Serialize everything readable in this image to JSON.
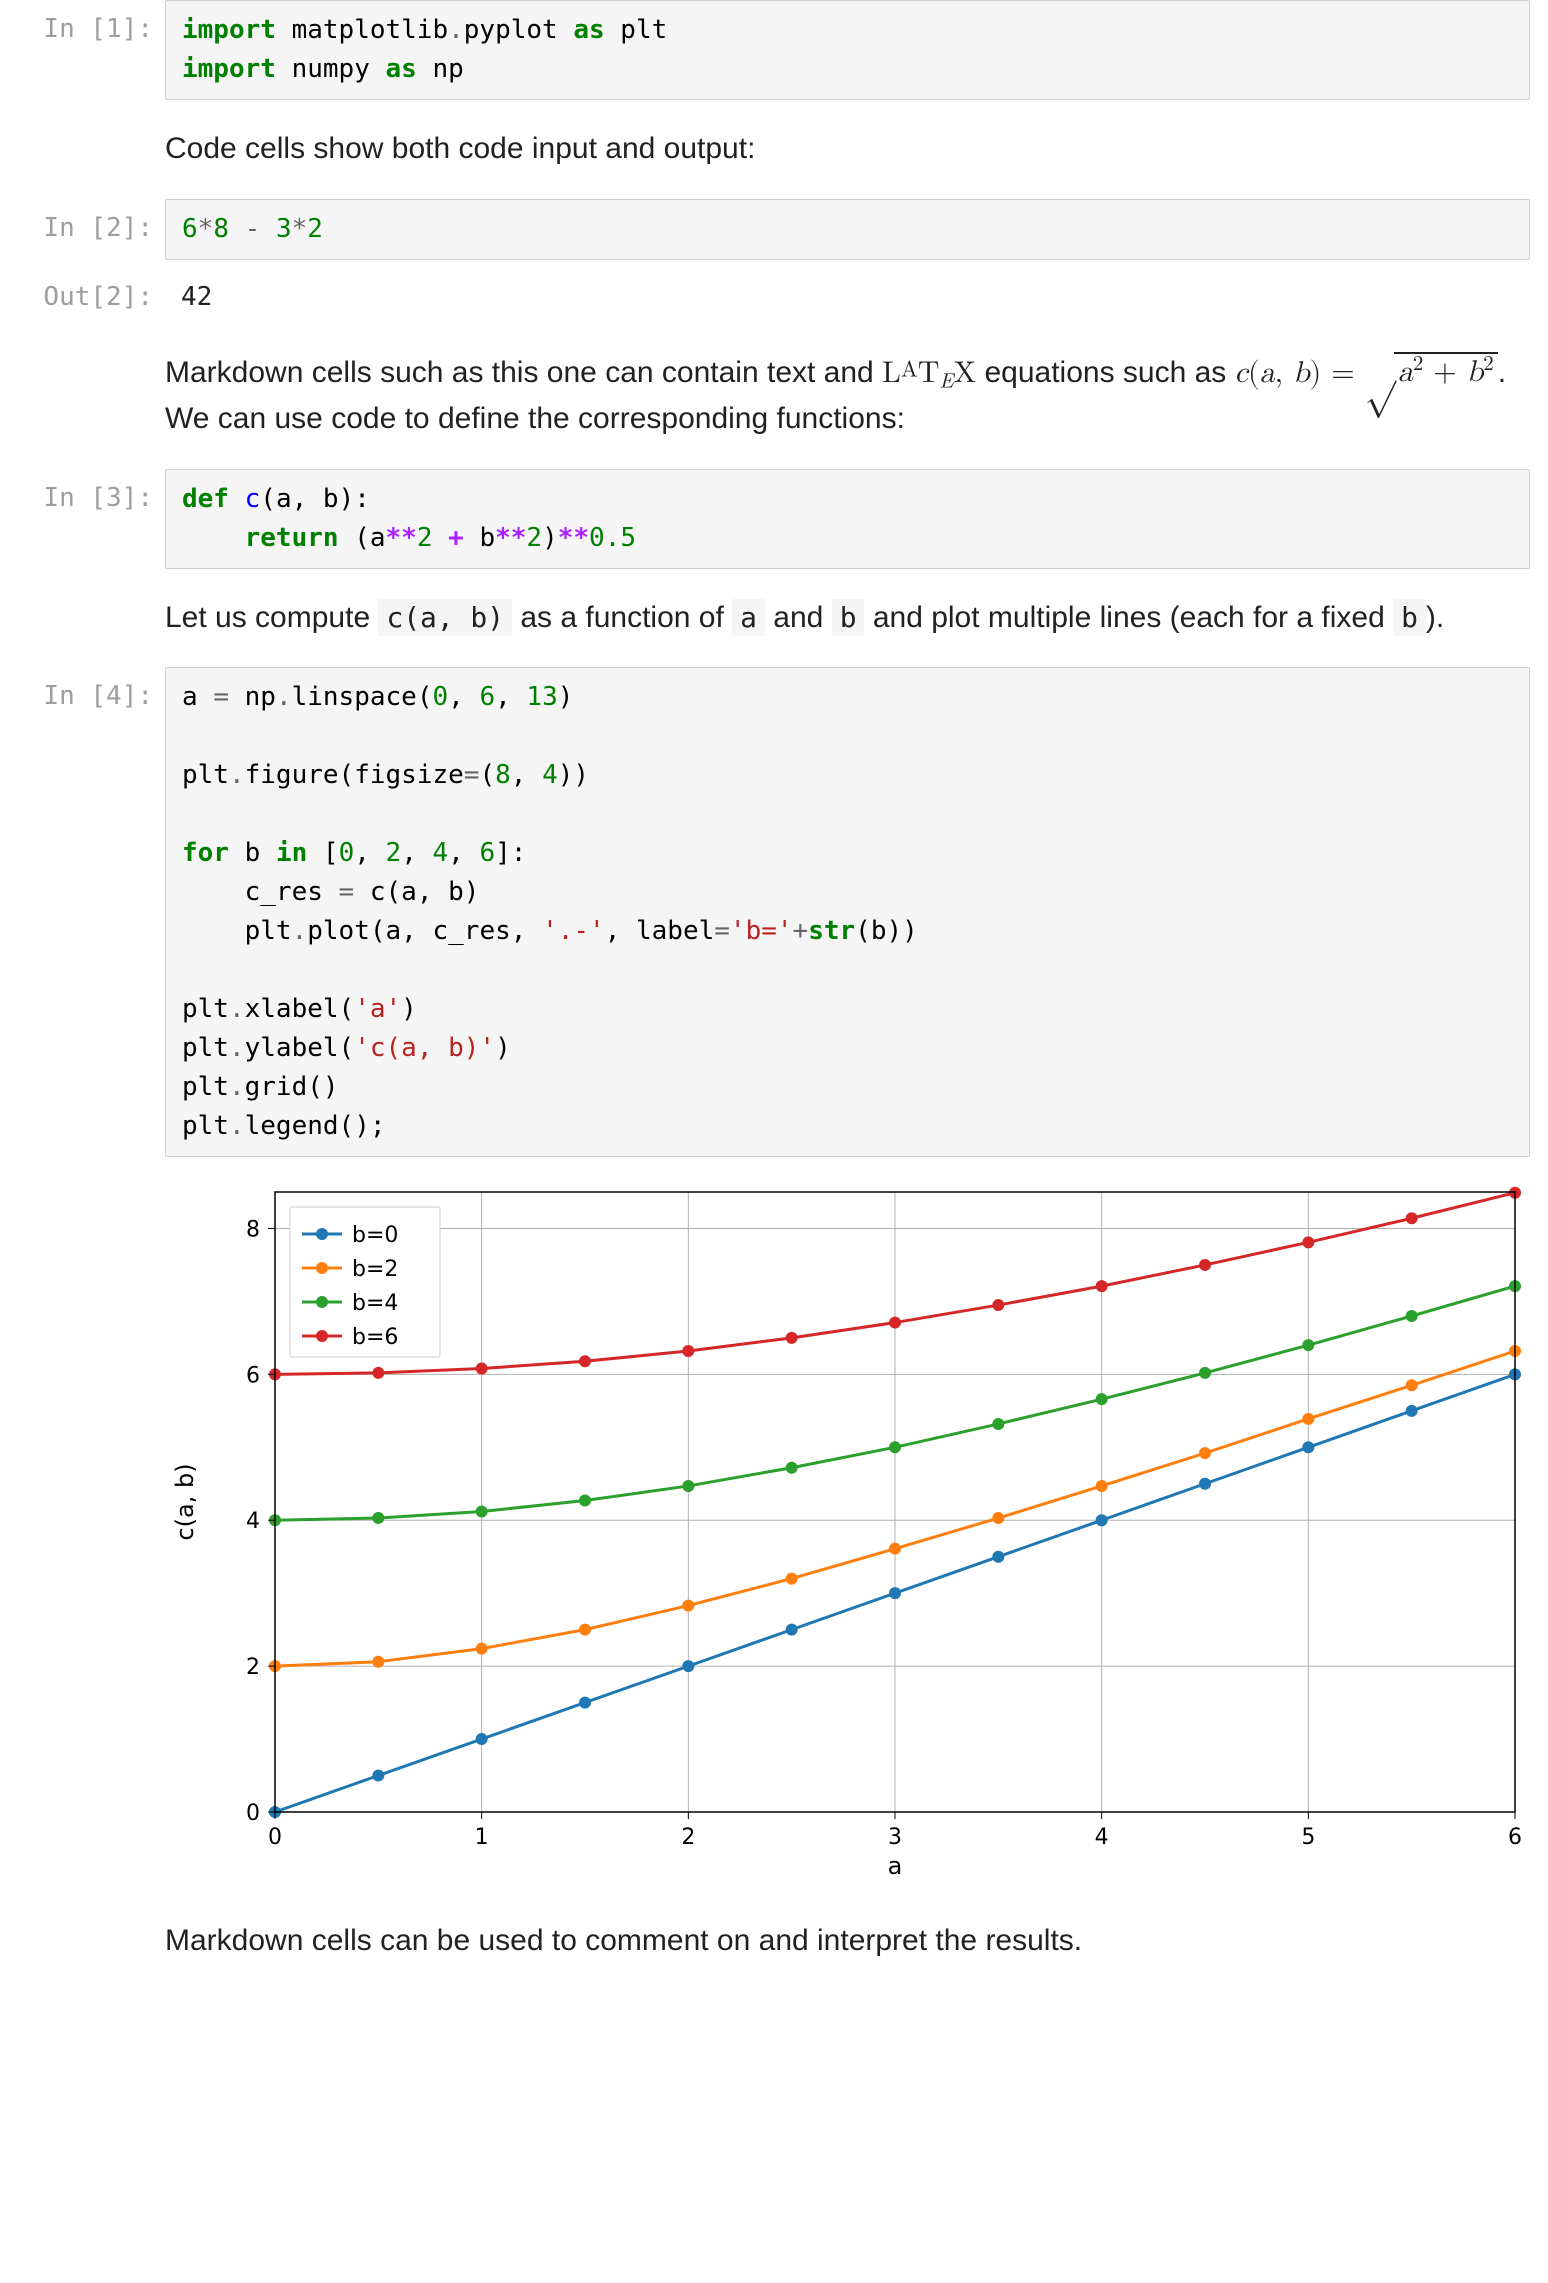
{
  "cells": {
    "c1": {
      "prompt": "In [1]:"
    },
    "c2": {
      "prompt": "In [2]:"
    },
    "c2out": {
      "prompt": "Out[2]:",
      "text": "42"
    },
    "c3": {
      "prompt": "In [3]:"
    },
    "c4": {
      "prompt": "In [4]:"
    }
  },
  "code": {
    "c1": {
      "l1": {
        "import": "import",
        "mod": " matplotlib",
        "dot": ".",
        "sub": "pyplot ",
        "as": "as",
        "alias": " plt"
      },
      "l2": {
        "import": "import",
        "mod": " numpy ",
        "as": "as",
        "alias": " np"
      }
    },
    "c2": {
      "l1": {
        "n1": "6",
        "op1": "*",
        "n2": "8",
        "sp": " ",
        "minus": "-",
        "sp2": " ",
        "n3": "3",
        "op2": "*",
        "n4": "2"
      }
    },
    "c3": {
      "l1": {
        "def": "def",
        "sp": " ",
        "name": "c",
        "open": "(",
        "a": "a",
        "comma": ",",
        "sp2": " ",
        "b": "b",
        "close": "):"
      },
      "l2": {
        "indent": "    ",
        "return": "return",
        "sp": " ",
        "open": "(",
        "a": "a",
        "pow1": "**",
        "two1": "2",
        "sp2": " ",
        "plus": "+",
        "sp3": " ",
        "b": "b",
        "pow2": "**",
        "two2": "2",
        "close": ")",
        "pow3": "**",
        "half": "0.5"
      }
    },
    "c4": {
      "l1": {
        "a": "a ",
        "eq": "=",
        "sp": " np",
        "dot": ".",
        "fn": "linspace",
        "open": "(",
        "n1": "0",
        "comma1": ",",
        "sp2": " ",
        "n2": "6",
        "comma2": ",",
        "sp3": " ",
        "n3": "13",
        "close": ")"
      },
      "l2": "",
      "l3": {
        "p1": "plt",
        "dot": ".",
        "fn": "figure",
        "open": "(",
        "kw": "figsize",
        "eq": "=",
        "popen": "(",
        "n1": "8",
        "comma": ",",
        "sp": " ",
        "n2": "4",
        "pclose": ")",
        "close": ")"
      },
      "l4": "",
      "l5": {
        "for": "for",
        "sp": " b ",
        "in": "in",
        "sp2": " [",
        "n1": "0",
        "c1": ",",
        "s1": " ",
        "n2": "2",
        "c2": ",",
        "s2": " ",
        "n3": "4",
        "c3": ",",
        "s3": " ",
        "n4": "6",
        "close": "]:"
      },
      "l6": {
        "indent": "    ",
        "v": "c_res ",
        "eq": "=",
        "sp": " c(a, b)"
      },
      "l7": {
        "indent": "    ",
        "p": "plt",
        "dot": ".",
        "fn": "plot",
        "open": "(a, c_res, ",
        "s1": "'.-'",
        "comma": ", label",
        "eq": "=",
        "s2": "'b='",
        "plus": "+",
        "str": "str",
        "args": "(b))"
      },
      "l8": "",
      "l9": {
        "p": "plt",
        "dot": ".",
        "fn": "xlabel",
        "open": "(",
        "s": "'a'",
        "close": ")"
      },
      "l10": {
        "p": "plt",
        "dot": ".",
        "fn": "ylabel",
        "open": "(",
        "s": "'c(a, b)'",
        "close": ")"
      },
      "l11": {
        "p": "plt",
        "dot": ".",
        "fn": "grid",
        "args": "()"
      },
      "l12": {
        "p": "plt",
        "dot": ".",
        "fn": "legend",
        "args": "();"
      }
    }
  },
  "markdown": {
    "m1": "Code cells show both code input and output:",
    "m2_pre": "Markdown cells such as this one can contain text and ",
    "m2_latex_word": "LATEX",
    "m2_mid": " equations such as ",
    "m2_eq_lhs": "c(a, b) = ",
    "m2_eq_rhs": "a² + b²",
    "m2_post": ". We can use code to define the corresponding functions:",
    "m3_pre": "Let us compute ",
    "m3_code1": "c(a, b)",
    "m3_mid1": " as a function of ",
    "m3_code2": "a",
    "m3_mid2": " and ",
    "m3_code3": "b",
    "m3_mid3": " and plot multiple lines (each for a fixed ",
    "m3_code4": "b",
    "m3_end": ").",
    "m4": "Markdown cells can be used to comment on and interpret the results."
  },
  "chart_data": {
    "type": "line",
    "xlabel": "a",
    "ylabel": "c(a, b)",
    "xlim": [
      0,
      6
    ],
    "ylim": [
      0,
      8.5
    ],
    "xticks": [
      0,
      1,
      2,
      3,
      4,
      5,
      6
    ],
    "yticks": [
      0,
      2,
      4,
      6,
      8
    ],
    "grid": true,
    "legend_position": "upper-left",
    "x": [
      0,
      0.5,
      1,
      1.5,
      2,
      2.5,
      3,
      3.5,
      4,
      4.5,
      5,
      5.5,
      6
    ],
    "series": [
      {
        "name": "b=0",
        "color": "#1f77b4",
        "values": [
          0,
          0.5,
          1,
          1.5,
          2,
          2.5,
          3,
          3.5,
          4,
          4.5,
          5,
          5.5,
          6
        ]
      },
      {
        "name": "b=2",
        "color": "#ff7f0e",
        "values": [
          2,
          2.06,
          2.24,
          2.5,
          2.83,
          3.2,
          3.61,
          4.03,
          4.47,
          4.92,
          5.39,
          5.85,
          6.32
        ]
      },
      {
        "name": "b=4",
        "color": "#2ca02c",
        "values": [
          4,
          4.03,
          4.12,
          4.27,
          4.47,
          4.72,
          5.0,
          5.32,
          5.66,
          6.02,
          6.4,
          6.8,
          7.21
        ]
      },
      {
        "name": "b=6",
        "color": "#d62728",
        "values": [
          6,
          6.02,
          6.08,
          6.18,
          6.32,
          6.5,
          6.71,
          6.95,
          7.21,
          7.5,
          7.81,
          8.14,
          8.49
        ]
      }
    ]
  }
}
